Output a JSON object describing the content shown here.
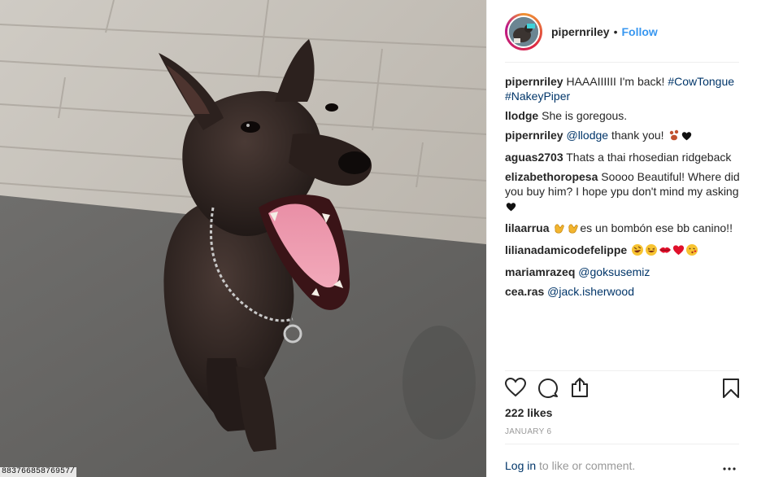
{
  "photo": {
    "id_label": "88376685876957/"
  },
  "header": {
    "username": "pipernriley",
    "separator": "•",
    "follow_label": "Follow"
  },
  "comments": [
    {
      "user": "pipernriley",
      "parts": [
        {
          "type": "text",
          "value": "HAAAIIIIII I'm back! "
        },
        {
          "type": "link",
          "value": "#CowTongue"
        },
        {
          "type": "text",
          "value": " "
        },
        {
          "type": "link",
          "value": "#NakeyPiper"
        }
      ]
    },
    {
      "user": "llodge",
      "parts": [
        {
          "type": "text",
          "value": "She is goregous."
        }
      ]
    },
    {
      "user": "pipernriley",
      "parts": [
        {
          "type": "link",
          "value": "@llodge"
        },
        {
          "type": "text",
          "value": " thank you! "
        },
        {
          "type": "emoji",
          "value": "paw-prints"
        },
        {
          "type": "emoji",
          "value": "black-heart"
        }
      ]
    },
    {
      "user": "aguas2703",
      "parts": [
        {
          "type": "text",
          "value": "Thats a thai rhosedian ridgeback"
        }
      ]
    },
    {
      "user": "elizabethoropesa",
      "parts": [
        {
          "type": "text",
          "value": "Soooo Beautiful! Where did you buy him? I hope ypu don't mind my asking"
        },
        {
          "type": "emoji",
          "value": "black-heart"
        }
      ]
    },
    {
      "user": "lilaarrua",
      "parts": [
        {
          "type": "emoji",
          "value": "clapping-hands"
        },
        {
          "type": "emoji",
          "value": "clapping-hands"
        },
        {
          "type": "text",
          "value": "es un bombón ese bb canino!!"
        }
      ]
    },
    {
      "user": "lilianadamicodefelippe",
      "parts": [
        {
          "type": "text",
          "value": " "
        },
        {
          "type": "emoji",
          "value": "rolling-laughing-face"
        },
        {
          "type": "emoji",
          "value": "grinning-squint-face"
        },
        {
          "type": "emoji",
          "value": "kiss-lips"
        },
        {
          "type": "emoji",
          "value": "red-heart"
        },
        {
          "type": "emoji",
          "value": "kissing-face"
        }
      ]
    },
    {
      "user": "mariamrazeq",
      "parts": [
        {
          "type": "link",
          "value": "@goksusemiz"
        }
      ]
    },
    {
      "user": "cea.ras",
      "parts": [
        {
          "type": "link",
          "value": "@jack.isherwood"
        }
      ]
    }
  ],
  "actions": {
    "icons": [
      "heart-icon",
      "comment-icon",
      "share-icon",
      "bookmark-icon"
    ],
    "likes": "222 likes",
    "date": "JANUARY 6"
  },
  "footer": {
    "login_link": "Log in",
    "login_suffix": " to like or comment.",
    "more_icon": "ellipsis-icon"
  },
  "colors": {
    "link_blue": "#3897f0",
    "hashtag_navy": "#003569",
    "text": "#262626",
    "muted": "#999999"
  }
}
